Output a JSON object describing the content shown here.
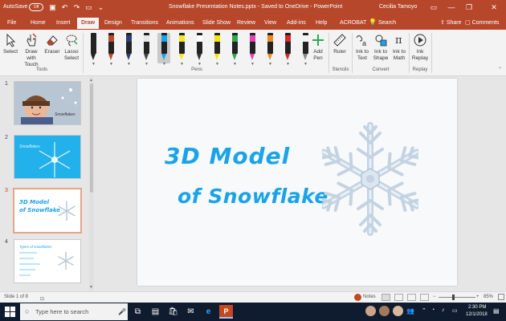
{
  "titlebar": {
    "autosave_label": "AutoSave",
    "autosave_state": "Off",
    "title": "Snowflake Presentation Notes.pptx  -  Saved to OneDrive  -  PowerPoint",
    "user": "Cecilia Tamoyo",
    "qa_icons": [
      "save-icon",
      "undo-icon",
      "redo-icon",
      "present-icon",
      "customize-icon"
    ],
    "window_buttons": {
      "ribbon": "▭",
      "minimize": "—",
      "restore": "❐",
      "close": "✕"
    }
  },
  "tabs": [
    {
      "label": "File"
    },
    {
      "label": "Home"
    },
    {
      "label": "Insert"
    },
    {
      "label": "Draw"
    },
    {
      "label": "Design"
    },
    {
      "label": "Transitions"
    },
    {
      "label": "Animations"
    },
    {
      "label": "Slide Show"
    },
    {
      "label": "Review"
    },
    {
      "label": "View"
    },
    {
      "label": "Add-ins"
    },
    {
      "label": "Help"
    },
    {
      "label": "ACROBAT"
    }
  ],
  "active_tab": "Draw",
  "tell_me": "Search",
  "share_label": "Share",
  "comments_label": "Comments",
  "ribbon": {
    "tools": {
      "select": "Select",
      "draw_touch": "Draw with Touch",
      "eraser": "Eraser",
      "lasso": "Lasso Select",
      "group": "Tools"
    },
    "pens_group": "Pens",
    "pens": [
      {
        "band": "#222222",
        "tip": "#222222"
      },
      {
        "band": "#b84a2e",
        "tip": "#b84a2e"
      },
      {
        "band": "#2e3e73",
        "tip": "#2e3e73"
      },
      {
        "band": "#e8e8e8",
        "tip": "#444444"
      },
      {
        "band": "#1aa3e8",
        "tip": "#1aa3e8",
        "selected": true
      },
      {
        "band": "#f2e81a",
        "tip": "#f2e81a"
      },
      {
        "band": "#ffffff",
        "tip": "#333333"
      },
      {
        "band": "#f5e600",
        "tip": "#f5e600"
      },
      {
        "band": "#2fa84f",
        "tip": "#2fa84f"
      },
      {
        "band": "#e83cb7",
        "tip": "#e83cb7"
      },
      {
        "band": "#f08a1c",
        "tip": "#f08a1c"
      },
      {
        "band": "#d8272d",
        "tip": "#d8272d"
      },
      {
        "band": "#f2f2f2",
        "tip": "#888888"
      }
    ],
    "add_pen": "Add Pen",
    "ruler": "Ruler",
    "stencils_group": "Stencils",
    "ink_to_text": "Ink to Text",
    "ink_to_shape": "Ink to Shape",
    "ink_to_math": "Ink to Math",
    "convert_group": "Convert",
    "ink_replay": "Ink Replay",
    "replay_group": "Replay"
  },
  "thumbnails": [
    {
      "num": "1",
      "caption": "Snowflakes"
    },
    {
      "num": "2",
      "caption": "Snowflakes"
    },
    {
      "num": "3",
      "line1": "3D Model",
      "line2": "of Snowflake",
      "current": true
    },
    {
      "num": "4",
      "caption": "Types of snowflakes"
    }
  ],
  "slide": {
    "line1": "3D Model",
    "line2": "of Snowflake"
  },
  "status": {
    "slide_info": "Slide 1 of 8",
    "notes": "Notes",
    "zoom": "85%"
  },
  "taskbar": {
    "search_placeholder": "Type here to search",
    "time": "2:30 PM",
    "date": "12/1/2018"
  }
}
